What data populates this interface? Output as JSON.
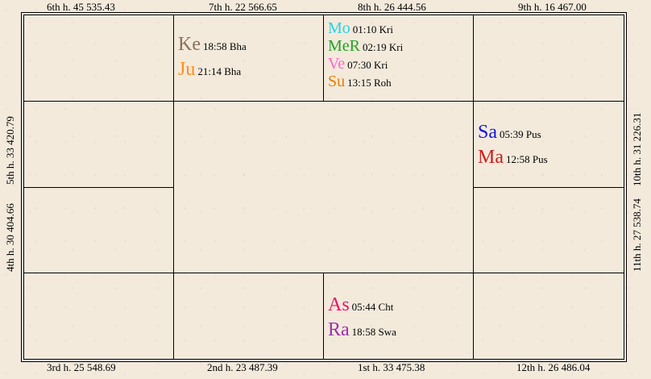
{
  "houses": {
    "h6": "6th h.  45  535.43",
    "h7": "7th h.  22  566.65",
    "h8": "8th h.  26  444.56",
    "h9": "9th h.  16  467.00",
    "h3": "3rd h.  25  548.69",
    "h2": "2nd h.  23  487.39",
    "h1": "1st h.  33  475.38",
    "h12": "12th h.  26  486.04",
    "h5": "5th h.  33  420.79",
    "h4": "4th h.  30  404.66",
    "h10": "10th h.  31  226.31",
    "h11": "11th h.  27  538.74"
  },
  "planets": {
    "ke": {
      "abbr": "Ke",
      "info": "18:58 Bha",
      "color": "#8b6f5a"
    },
    "ju": {
      "abbr": "Ju",
      "info": "21:14 Bha",
      "color": "#ff8c1a"
    },
    "mo": {
      "abbr": "Mo",
      "info": "01:10 Kri",
      "color": "#22d3e8"
    },
    "mer": {
      "abbr": "MeR",
      "info": "02:19 Kri",
      "color": "#1fa31f"
    },
    "ve": {
      "abbr": "Ve",
      "info": "07:30 Kri",
      "color": "#ff66cc"
    },
    "su": {
      "abbr": "Su",
      "info": "13:15 Roh",
      "color": "#e67e00"
    },
    "sa": {
      "abbr": "Sa",
      "info": "05:39 Pus",
      "color": "#1414d6"
    },
    "ma": {
      "abbr": "Ma",
      "info": "12:58 Pus",
      "color": "#d11a1a"
    },
    "as": {
      "abbr": "As",
      "info": "05:44 Cht",
      "color": "#ee1166"
    },
    "ra": {
      "abbr": "Ra",
      "info": "18:58 Swa",
      "color": "#a030b0"
    }
  }
}
